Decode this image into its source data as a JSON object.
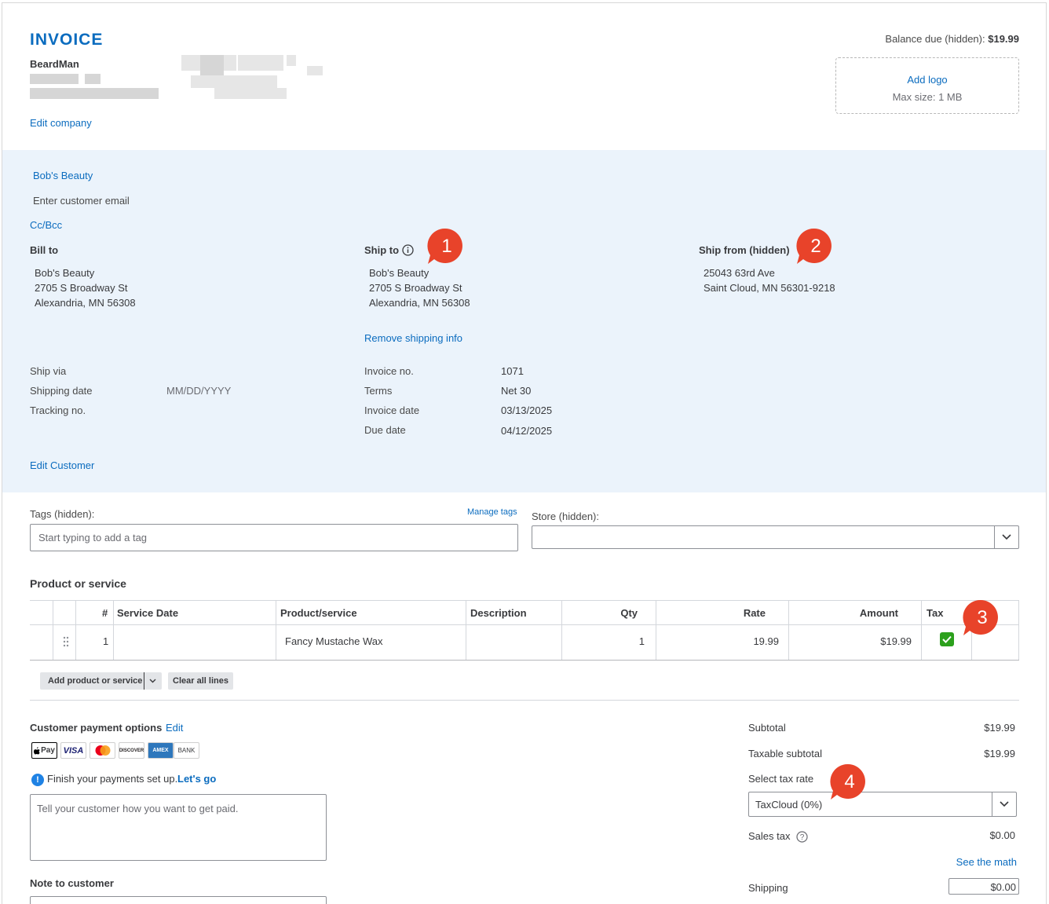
{
  "header": {
    "title": "INVOICE",
    "company_name": "BeardMan",
    "edit_company": "Edit company",
    "balance_label": "Balance due (hidden):",
    "balance_value": "$19.99",
    "add_logo": "Add logo",
    "logo_max_size": "Max size: 1 MB"
  },
  "customer": {
    "name": "Bob's Beauty",
    "email_placeholder": "Enter customer email",
    "cc_bcc": "Cc/Bcc"
  },
  "bill_to": {
    "label": "Bill to",
    "lines": [
      "Bob's Beauty",
      "2705 S Broadway St",
      "Alexandria, MN  56308"
    ]
  },
  "ship_to": {
    "label": "Ship to",
    "lines": [
      "Bob's Beauty",
      "2705 S Broadway St",
      "Alexandria, MN  56308"
    ],
    "remove": "Remove shipping info"
  },
  "ship_from": {
    "label": "Ship from (hidden)",
    "lines": [
      "25043 63rd Ave",
      "Saint Cloud, MN 56301-9218"
    ]
  },
  "shipping": {
    "ship_via": "Ship via",
    "shipping_date": "Shipping date",
    "shipping_date_placeholder": "MM/DD/YYYY",
    "tracking": "Tracking no."
  },
  "invoice_meta": {
    "invoice_no_label": "Invoice no.",
    "invoice_no": "1071",
    "terms_label": "Terms",
    "terms": "Net 30",
    "invoice_date_label": "Invoice date",
    "invoice_date": "03/13/2025",
    "due_date_label": "Due date",
    "due_date": "04/12/2025"
  },
  "edit_customer": "Edit Customer",
  "tags": {
    "label": "Tags (hidden):",
    "manage": "Manage tags",
    "placeholder": "Start typing to add a tag"
  },
  "store": {
    "label": "Store (hidden):"
  },
  "products": {
    "section_title": "Product or service",
    "columns": [
      "#",
      "Service Date",
      "Product/service",
      "Description",
      "Qty",
      "Rate",
      "Amount",
      "Tax"
    ],
    "rows": [
      {
        "num": "1",
        "service_date": "",
        "product": "Fancy Mustache Wax",
        "description": "",
        "qty": "1",
        "rate": "19.99",
        "amount": "$19.99",
        "tax": true
      }
    ],
    "add_button": "Add product or service",
    "clear_button": "Clear all lines"
  },
  "payment": {
    "title": "Customer payment options",
    "edit": "Edit",
    "methods": [
      "Pay",
      "VISA",
      "mastercard",
      "DISCOVER",
      "AMEX",
      "BANK"
    ],
    "setup_text": "Finish your payments set up.",
    "setup_link": "Let's go",
    "placeholder": "Tell your customer how you want to get paid.",
    "note_label": "Note to customer"
  },
  "totals": {
    "subtotal_label": "Subtotal",
    "subtotal": "$19.99",
    "taxable_label": "Taxable subtotal",
    "taxable": "$19.99",
    "tax_rate_label": "Select tax rate",
    "tax_rate": "TaxCloud (0%)",
    "sales_tax_label": "Sales tax",
    "sales_tax": "$0.00",
    "see_math": "See the math",
    "shipping_label": "Shipping",
    "shipping": "$0.00"
  },
  "callouts": [
    "1",
    "2",
    "3",
    "4"
  ],
  "colors": {
    "accent": "#0b6cbf",
    "callout": "#e8432a",
    "section_bg": "#ebf3fb",
    "check": "#2ca01c"
  }
}
